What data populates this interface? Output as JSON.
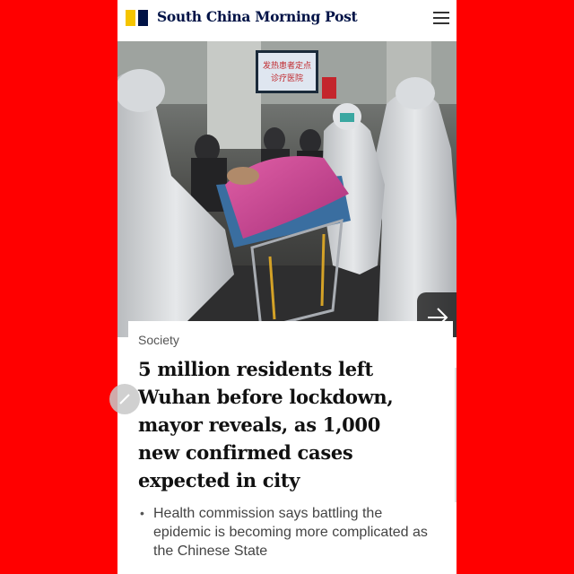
{
  "header": {
    "brand": "South China Morning Post",
    "menu_icon": "hamburger-menu-icon",
    "logo_colors": [
      "#f5c400",
      "#001246"
    ]
  },
  "hero": {
    "sign_text_line1": "发热患者定点",
    "sign_text_line2": "诊疗医院",
    "next_icon": "arrow-right-icon"
  },
  "article": {
    "section": "Society",
    "headline": "5 million residents left Wuhan before lockdown, mayor reveals, as 1,000 new confirmed cases expected in city",
    "bullets": [
      "Health commission says battling the epidemic is becoming more complicated as the Chinese State"
    ]
  },
  "colors": {
    "background": "#ff0000",
    "brand_navy": "#001246",
    "brand_yellow": "#f5c400"
  }
}
